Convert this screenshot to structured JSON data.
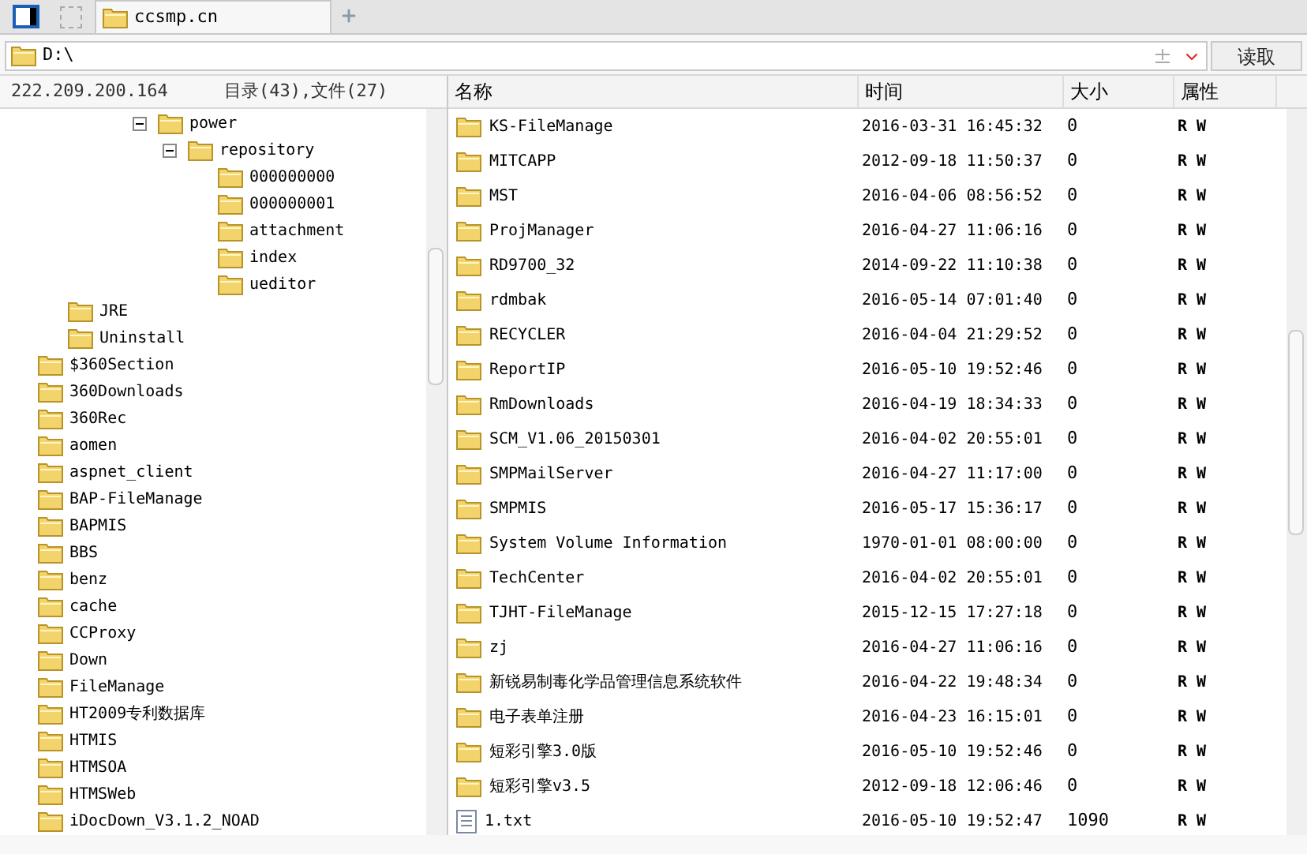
{
  "tabs": [
    {
      "label": "ccsmp.cn",
      "selected": true
    }
  ],
  "address": {
    "value": "D:\\",
    "button": "读取"
  },
  "left_header": {
    "host": "222.209.200.164",
    "summary": "目录(43),文件(27)"
  },
  "tree": [
    {
      "children": [
        {
          "children": [
            {
              "children": [
                {
                  "children": [
                    {
                      "label": "power",
                      "expanded": true,
                      "children": [
                        {
                          "label": "repository",
                          "expanded": true,
                          "children": [
                            {
                              "label": "000000000"
                            },
                            {
                              "label": "000000001"
                            },
                            {
                              "label": "attachment"
                            },
                            {
                              "label": "index"
                            },
                            {
                              "label": "ueditor"
                            }
                          ]
                        }
                      ]
                    }
                  ]
                }
              ]
            }
          ]
        },
        {
          "label": "JRE"
        },
        {
          "label": "Uninstall"
        }
      ]
    },
    {
      "label": "$360Section"
    },
    {
      "label": "360Downloads"
    },
    {
      "label": "360Rec"
    },
    {
      "label": "aomen"
    },
    {
      "label": "aspnet_client"
    },
    {
      "label": "BAP-FileManage"
    },
    {
      "label": "BAPMIS"
    },
    {
      "label": "BBS"
    },
    {
      "label": "benz"
    },
    {
      "label": "cache"
    },
    {
      "label": "CCProxy"
    },
    {
      "label": "Down"
    },
    {
      "label": "FileManage"
    },
    {
      "label": "HT2009专利数据库"
    },
    {
      "label": "HTMIS"
    },
    {
      "label": "HTMSOA"
    },
    {
      "label": "HTMSWeb"
    },
    {
      "label": "iDocDown_V3.1.2_NOAD"
    }
  ],
  "table": {
    "columns": [
      "名称",
      "时间",
      "大小",
      "属性"
    ],
    "rows": [
      {
        "kind": "folder",
        "name": "KS-FileManage",
        "time": "2016-03-31 16:45:32",
        "size": "0",
        "attr": "R W"
      },
      {
        "kind": "folder",
        "name": "MITCAPP",
        "time": "2012-09-18 11:50:37",
        "size": "0",
        "attr": "R W"
      },
      {
        "kind": "folder",
        "name": "MST",
        "time": "2016-04-06 08:56:52",
        "size": "0",
        "attr": "R W"
      },
      {
        "kind": "folder",
        "name": "ProjManager",
        "time": "2016-04-27 11:06:16",
        "size": "0",
        "attr": "R W"
      },
      {
        "kind": "folder",
        "name": "RD9700_32",
        "time": "2014-09-22 11:10:38",
        "size": "0",
        "attr": "R W"
      },
      {
        "kind": "folder",
        "name": "rdmbak",
        "time": "2016-05-14 07:01:40",
        "size": "0",
        "attr": "R W"
      },
      {
        "kind": "folder",
        "name": "RECYCLER",
        "time": "2016-04-04 21:29:52",
        "size": "0",
        "attr": "R W"
      },
      {
        "kind": "folder",
        "name": "ReportIP",
        "time": "2016-05-10 19:52:46",
        "size": "0",
        "attr": "R W"
      },
      {
        "kind": "folder",
        "name": "RmDownloads",
        "time": "2016-04-19 18:34:33",
        "size": "0",
        "attr": "R W"
      },
      {
        "kind": "folder",
        "name": "SCM_V1.06_20150301",
        "time": "2016-04-02 20:55:01",
        "size": "0",
        "attr": "R W"
      },
      {
        "kind": "folder",
        "name": "SMPMailServer",
        "time": "2016-04-27 11:17:00",
        "size": "0",
        "attr": "R W"
      },
      {
        "kind": "folder",
        "name": "SMPMIS",
        "time": "2016-05-17 15:36:17",
        "size": "0",
        "attr": "R W"
      },
      {
        "kind": "folder",
        "name": "System Volume Information",
        "time": "1970-01-01 08:00:00",
        "size": "0",
        "attr": "R W"
      },
      {
        "kind": "folder",
        "name": "TechCenter",
        "time": "2016-04-02 20:55:01",
        "size": "0",
        "attr": "R W"
      },
      {
        "kind": "folder",
        "name": "TJHT-FileManage",
        "time": "2015-12-15 17:27:18",
        "size": "0",
        "attr": "R W"
      },
      {
        "kind": "folder",
        "name": "zj",
        "time": "2016-04-27 11:06:16",
        "size": "0",
        "attr": "R W"
      },
      {
        "kind": "folder",
        "name": "新锐易制毒化学品管理信息系统软件",
        "time": "2016-04-22 19:48:34",
        "size": "0",
        "attr": "R W"
      },
      {
        "kind": "folder",
        "name": "电子表单注册",
        "time": "2016-04-23 16:15:01",
        "size": "0",
        "attr": "R W"
      },
      {
        "kind": "folder",
        "name": "短彩引擎3.0版",
        "time": "2016-05-10 19:52:46",
        "size": "0",
        "attr": "R W"
      },
      {
        "kind": "folder",
        "name": "短彩引擎v3.5",
        "time": "2012-09-18 12:06:46",
        "size": "0",
        "attr": "R W"
      },
      {
        "kind": "file",
        "name": "1.txt",
        "time": "2016-05-10 19:52:47",
        "size": "1090",
        "attr": "R W"
      }
    ]
  }
}
